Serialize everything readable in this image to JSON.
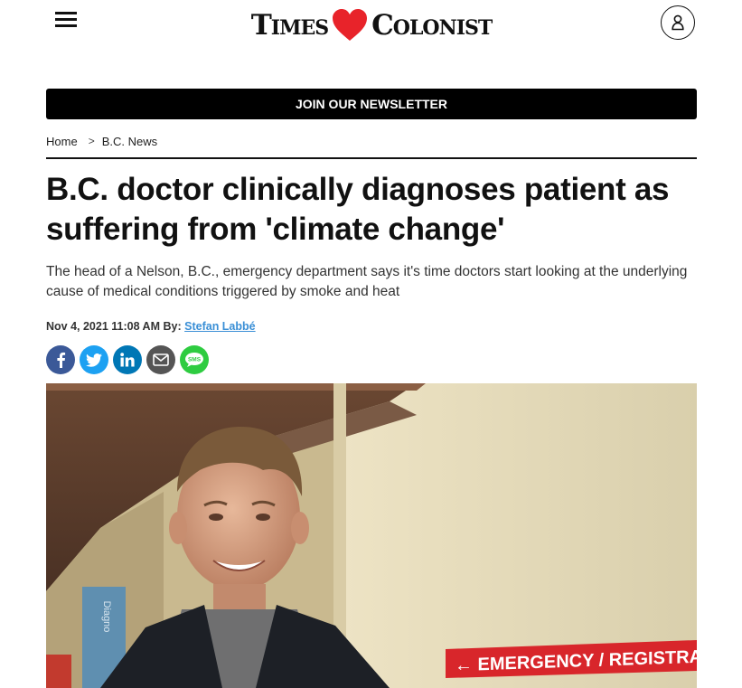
{
  "header": {
    "logo_left": "Times",
    "logo_right": "Colonist",
    "brand_heart_color": "#e8232a"
  },
  "newsletter": {
    "label": "JOIN OUR NEWSLETTER"
  },
  "breadcrumb": {
    "home": "Home",
    "separator": ">",
    "section": "B.C. News"
  },
  "article": {
    "headline": "B.C. doctor clinically diagnoses patient as suffering from 'climate change'",
    "dek": "The head of a Nelson, B.C., emergency department says it's time doctors start looking at the underlying cause of medical conditions triggered by smoke and heat",
    "date": "Nov 4, 2021 11:08 AM",
    "by_label": "By:",
    "author": "Stefan Labbé"
  },
  "share": [
    {
      "name": "facebook-icon",
      "color": "#3b5998"
    },
    {
      "name": "twitter-icon",
      "color": "#1da1f2"
    },
    {
      "name": "linkedin-icon",
      "color": "#0077b5"
    },
    {
      "name": "email-icon",
      "color": "#555555"
    },
    {
      "name": "sms-icon",
      "color": "#2ecc40"
    }
  ],
  "photo": {
    "sign_text": "EMERGENCY / REGISTRATION",
    "wall_sign_text": "Diagno",
    "sign_color": "#d8262b"
  }
}
